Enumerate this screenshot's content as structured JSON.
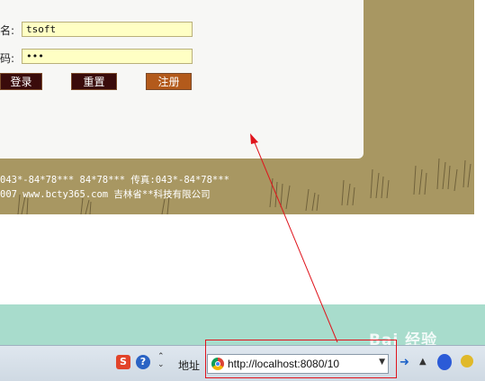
{
  "login_form": {
    "username_label": "名:",
    "username_value": "tsoft",
    "password_label": "码:",
    "password_value": "•••",
    "login_button": "登录",
    "reset_button": "重置",
    "register_button": "注册"
  },
  "footer": {
    "line1": "043*-84*78*** 84*78*** 传真:043*-84*78***",
    "line2": "007 www.bcty365.com 吉林省**科技有限公司"
  },
  "taskbar": {
    "address_label": "地址",
    "address_url": "http://localhost:8080/10",
    "sogou_icon": "S",
    "help_icon": "?"
  },
  "watermark_text": "Bai 经验",
  "colors": {
    "ground": "#a89762",
    "card": "#f7f7f5",
    "field_bg": "#ffffc4",
    "btn_dark": "#3a0b0b",
    "btn_register": "#b35a1b",
    "teal": "#a8dccc",
    "annotation_red": "#e0141c"
  }
}
